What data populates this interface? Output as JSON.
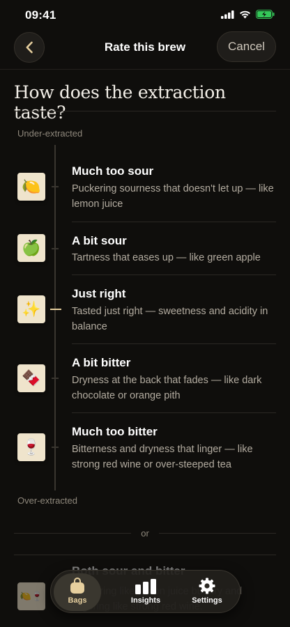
{
  "status_bar": {
    "time": "09:41"
  },
  "nav": {
    "title": "Rate this brew",
    "cancel_label": "Cancel"
  },
  "question": "How does the extraction taste?",
  "scale": {
    "top_label": "Under-extracted",
    "bottom_label": "Over-extracted"
  },
  "options": [
    {
      "title": "Much too sour",
      "description": "Puckering sourness that doesn't let up — like lemon juice",
      "icon": "lemon-icon",
      "emoji": "🍋"
    },
    {
      "title": "A bit sour",
      "description": "Tartness that eases up — like green apple",
      "icon": "green-apple-icon",
      "emoji": "🍏"
    },
    {
      "title": "Just right",
      "description": "Tasted just right — sweetness and acidity in balance",
      "icon": "sparkles-icon",
      "emoji": "✨"
    },
    {
      "title": "A bit bitter",
      "description": "Dryness at the back that fades — like dark chocolate or orange pith",
      "icon": "chocolate-icon",
      "emoji": "🍫"
    },
    {
      "title": "Much too bitter",
      "description": "Bitterness and dryness that linger — like strong red wine or over-steeped tea",
      "icon": "red-wine-icon",
      "emoji": "🍷"
    }
  ],
  "selected_option": "Just right",
  "divider_label": "or",
  "hidden_option": {
    "title": "Both sour and bitter",
    "description": "Puckering like lemon juice but dry and lingering like strong red wine.",
    "emoji": "🍋🍷"
  },
  "tab_bar": {
    "active": "Bags",
    "tabs": [
      {
        "label": "Bags",
        "icon": "bag-icon"
      },
      {
        "label": "Insights",
        "icon": "bar-chart-icon"
      },
      {
        "label": "Settings",
        "icon": "gear-icon"
      }
    ]
  },
  "colors": {
    "background": "#0f0e0c",
    "accent": "#e6cf9e",
    "tile": "#efe4cc",
    "battery": "#34c759"
  }
}
